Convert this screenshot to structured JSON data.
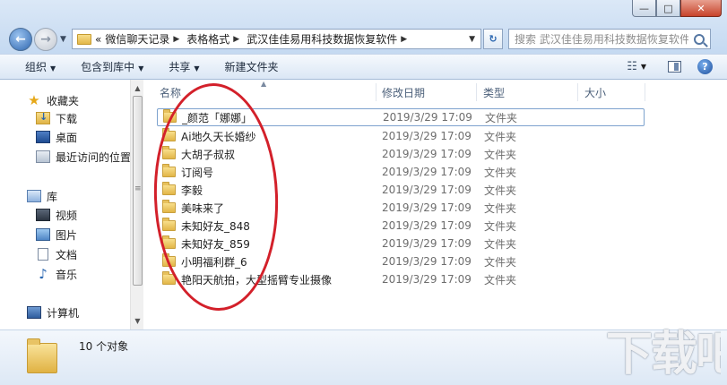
{
  "window": {
    "minimize": "—",
    "maximize": "□",
    "close": "✕"
  },
  "address": {
    "overflow": "«",
    "crumbs": [
      "微信聊天记录",
      "表格格式",
      "武汉佳佳易用科技数据恢复软件"
    ],
    "search_placeholder": "搜索 武汉佳佳易用科技数据恢复软件"
  },
  "toolbar": {
    "organize": "组织",
    "include_library": "包含到库中",
    "share": "共享",
    "new_folder": "新建文件夹"
  },
  "nav": {
    "favorites": "收藏夹",
    "downloads": "下载",
    "desktop": "桌面",
    "recent": "最近访问的位置",
    "libraries": "库",
    "videos": "视频",
    "pictures": "图片",
    "documents": "文档",
    "music": "音乐",
    "computer": "计算机"
  },
  "columns": {
    "name": "名称",
    "date": "修改日期",
    "type": "类型",
    "size": "大小"
  },
  "files": [
    {
      "name": "_颜范「娜娜」",
      "date": "2019/3/29 17:09",
      "type": "文件夹"
    },
    {
      "name": "Ai地久天长婚纱",
      "date": "2019/3/29 17:09",
      "type": "文件夹"
    },
    {
      "name": "大胡子叔叔",
      "date": "2019/3/29 17:09",
      "type": "文件夹"
    },
    {
      "name": "订阅号",
      "date": "2019/3/29 17:09",
      "type": "文件夹"
    },
    {
      "name": "李毅",
      "date": "2019/3/29 17:09",
      "type": "文件夹"
    },
    {
      "name": "美味来了",
      "date": "2019/3/29 17:09",
      "type": "文件夹"
    },
    {
      "name": "未知好友_848",
      "date": "2019/3/29 17:09",
      "type": "文件夹"
    },
    {
      "name": "未知好友_859",
      "date": "2019/3/29 17:09",
      "type": "文件夹"
    },
    {
      "name": "小明福利群_6",
      "date": "2019/3/29 17:09",
      "type": "文件夹"
    },
    {
      "name": "艳阳天航拍，大型摇臂专业摄像",
      "date": "2019/3/29 17:09",
      "type": "文件夹"
    }
  ],
  "status": {
    "count": "10 个对象"
  },
  "watermark": {
    "text": "下载吧"
  }
}
